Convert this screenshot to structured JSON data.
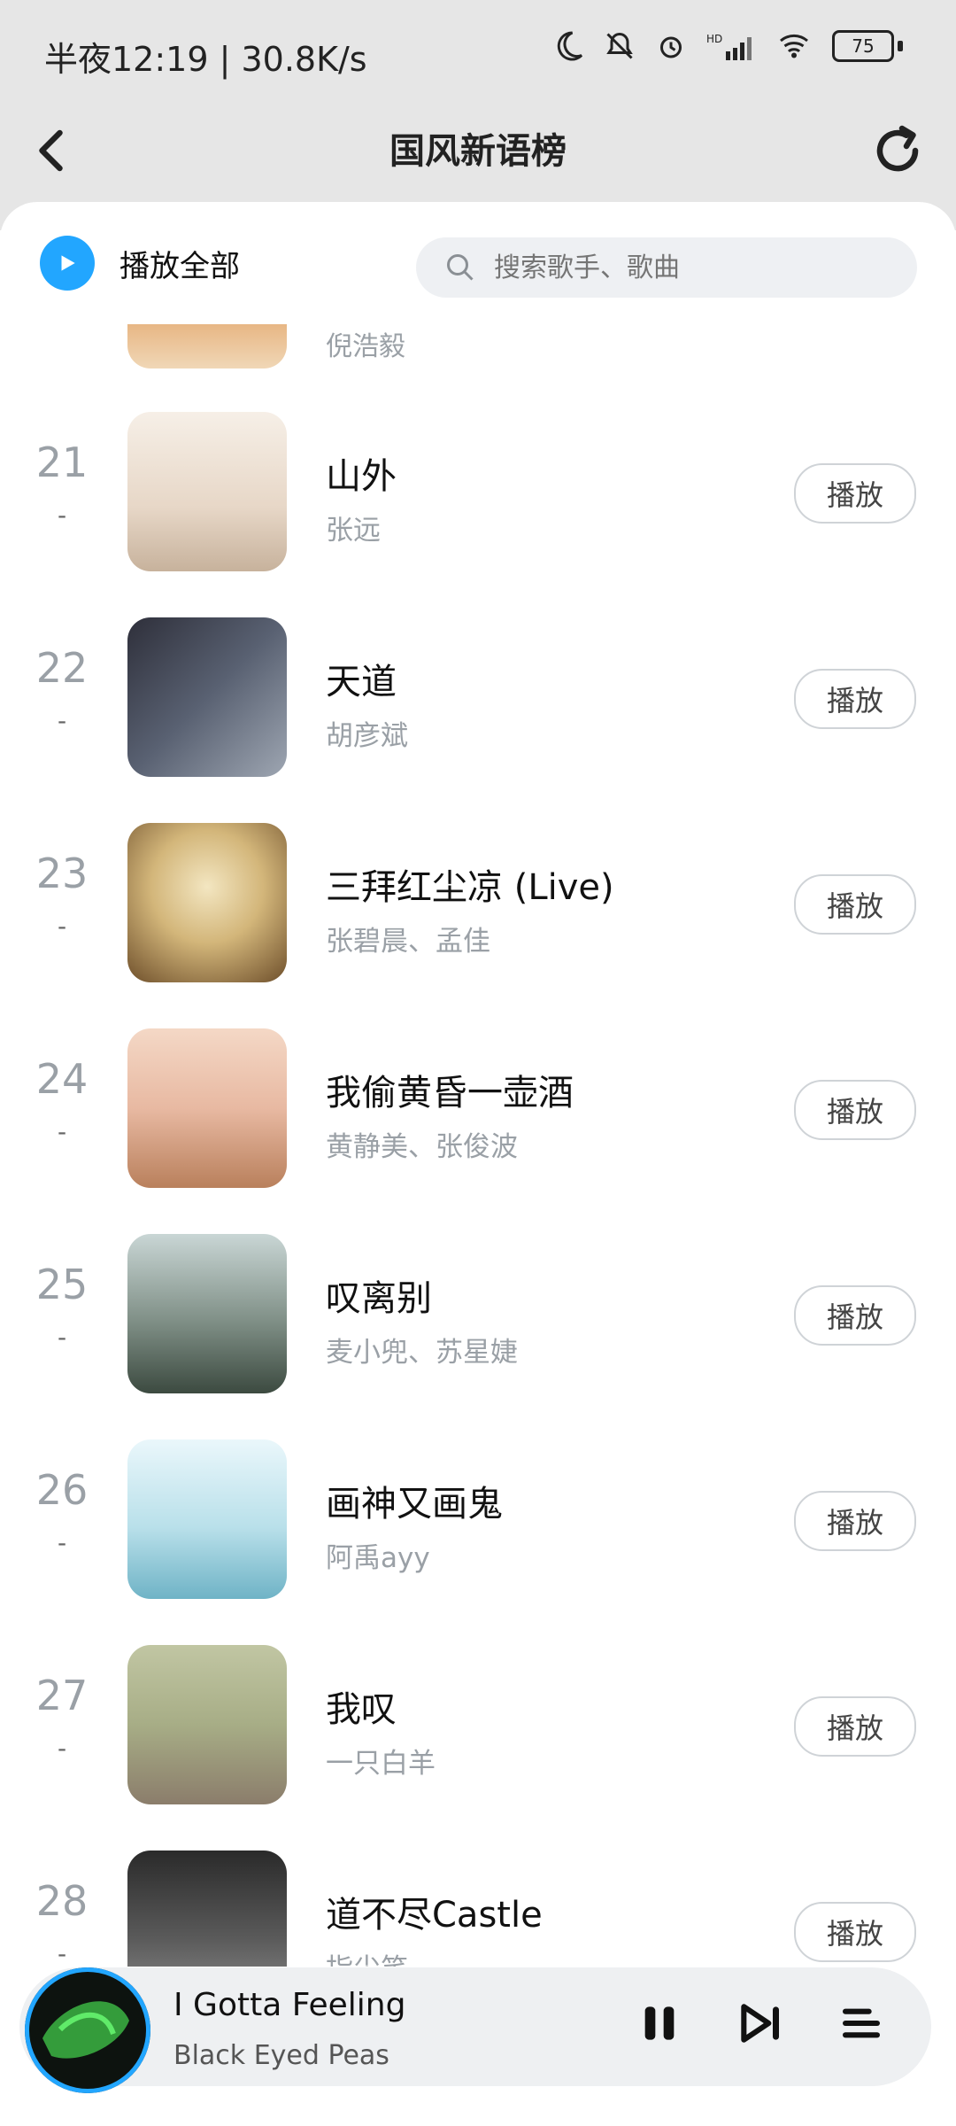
{
  "status": {
    "time_text": "半夜12:19 | 30.8K/s",
    "battery": "75",
    "icons": [
      "moon-icon",
      "bell-off-icon",
      "alarm-icon",
      "hd-signal-icon",
      "wifi-icon",
      "battery-icon"
    ]
  },
  "header": {
    "title": "国风新语榜",
    "back_icon": "chevron-left-icon",
    "refresh_icon": "refresh-icon"
  },
  "toolbar": {
    "play_all": "播放全部",
    "search_placeholder": "搜索歌手、歌曲"
  },
  "partial_top": {
    "artist": "倪浩毅"
  },
  "list": {
    "items": [
      {
        "rank": "21",
        "change": "-",
        "title": "山外",
        "artist": "张远",
        "play": "播放"
      },
      {
        "rank": "22",
        "change": "-",
        "title": "天道",
        "artist": "胡彦斌",
        "play": "播放"
      },
      {
        "rank": "23",
        "change": "-",
        "title": "三拜红尘凉 (Live)",
        "artist": "张碧晨、孟佳",
        "play": "播放"
      },
      {
        "rank": "24",
        "change": "-",
        "title": "我偷黄昏一壶酒",
        "artist": "黄静美、张俊波",
        "play": "播放"
      },
      {
        "rank": "25",
        "change": "-",
        "title": "叹离别",
        "artist": "麦小兜、苏星婕",
        "play": "播放"
      },
      {
        "rank": "26",
        "change": "-",
        "title": "画神又画鬼",
        "artist": "阿禹ayy",
        "play": "播放"
      },
      {
        "rank": "27",
        "change": "-",
        "title": "我叹",
        "artist": "一只白羊",
        "play": "播放"
      },
      {
        "rank": "28",
        "change": "-",
        "title": "道不尽Castle",
        "artist": "指尖笑",
        "play": "播放"
      }
    ]
  },
  "mini_player": {
    "title": "I Gotta Feeling",
    "artist": "Black Eyed Peas",
    "controls": [
      "pause-icon",
      "next-icon",
      "playlist-icon"
    ]
  },
  "colors": {
    "accent": "#22a6ff",
    "header_bg": "#e6e6e6",
    "muted_text": "#9aa0a6"
  }
}
